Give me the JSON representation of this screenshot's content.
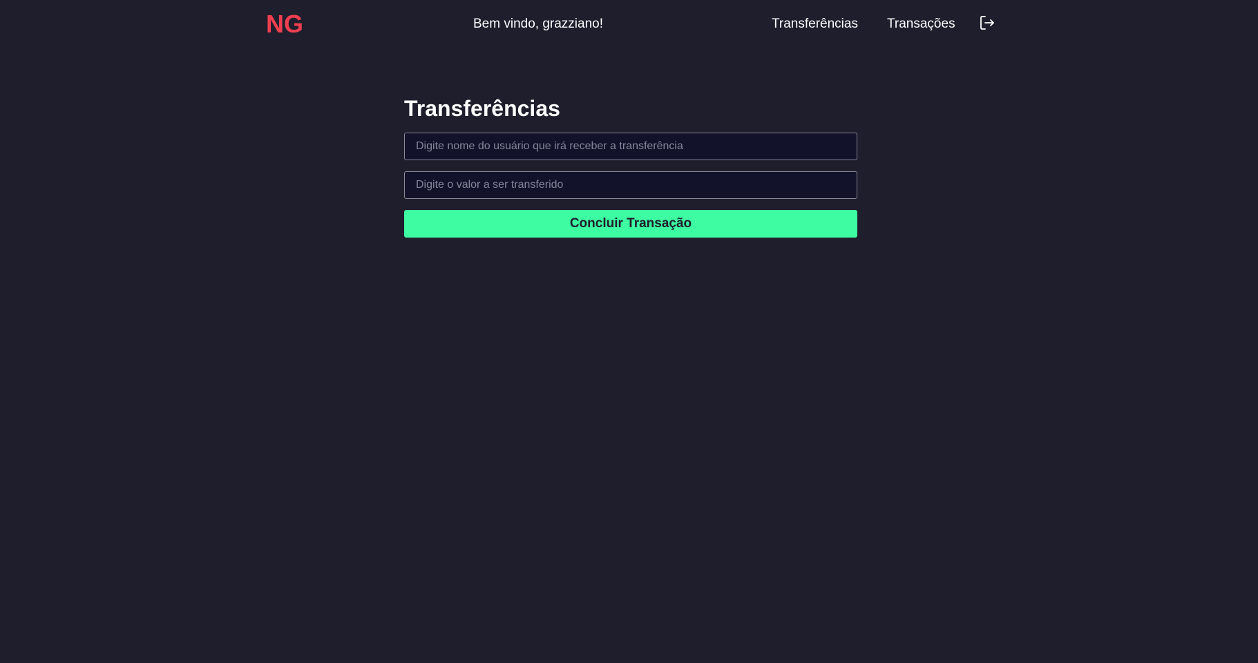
{
  "header": {
    "logo": "NG",
    "welcome": "Bem vindo, grazziano!",
    "nav": {
      "transfers": "Transferências",
      "transactions": "Transações"
    },
    "logout_icon": "logout-icon"
  },
  "form": {
    "title": "Transferências",
    "recipient_placeholder": "Digite nome do usuário que irá receber a transferência",
    "recipient_value": "",
    "amount_placeholder": "Digite o valor a ser transferido",
    "amount_value": "",
    "submit_label": "Concluir Transação"
  },
  "colors": {
    "background": "#1f1e2d",
    "logo": "#ef3f4f",
    "accent": "#3dfca1",
    "input_bg": "#12122a"
  }
}
